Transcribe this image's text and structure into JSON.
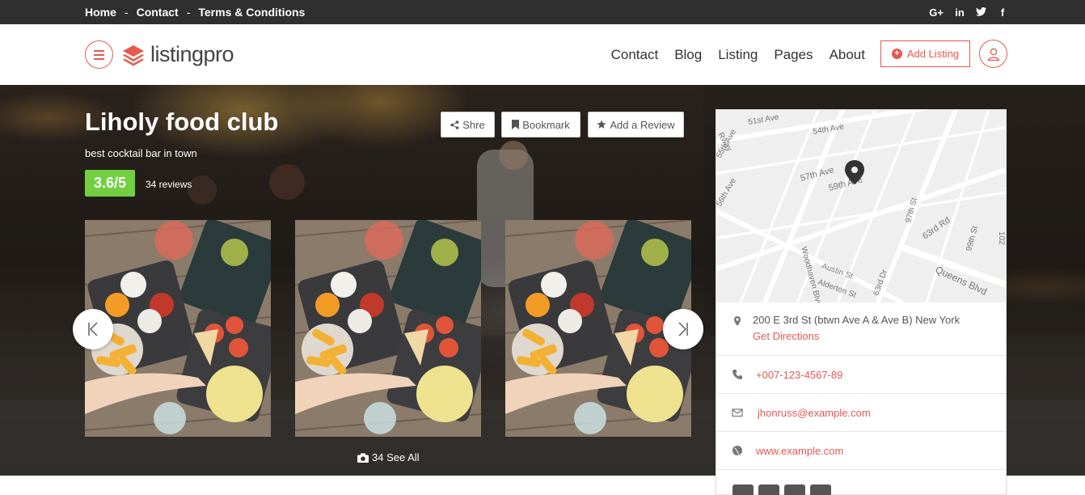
{
  "topnav": {
    "home": "Home",
    "sep1": "-",
    "contact": "Contact",
    "sep2": "-",
    "terms": "Terms & Conditions"
  },
  "social": {
    "gplus": "G+",
    "linkedin": "in",
    "twitter": "🐦",
    "facebook": "f"
  },
  "header": {
    "logo_text": "listingpro",
    "nav": [
      "Contact",
      "Blog",
      "Listing",
      "Pages",
      "About"
    ],
    "add_listing": "Add Listing"
  },
  "listing": {
    "title": "Liholy food club",
    "tagline": "best cocktail bar in town",
    "rating": "3.6/5",
    "reviews": "34 reviews",
    "actions": {
      "share": "Shre",
      "bookmark": "Bookmark",
      "review": "Add a Review"
    },
    "see_all": "34 See All"
  },
  "map": {
    "streets": [
      "51st Ave",
      "54th Ave",
      "57th Ave",
      "59th Ave",
      "56th Ave",
      "55th Ave",
      "97th St",
      "63rd Rd",
      "99th St",
      "Queens Blvd",
      "Austin St",
      "Alderton St",
      "63rd Dr",
      "Woodhaven Blvd",
      "65th Ave",
      "Rway",
      "102"
    ]
  },
  "contact": {
    "address": "200 E 3rd St (btwn Ave A & Ave B) New York",
    "directions": "Get Directions",
    "phone": "+007-123-4567-89",
    "email": "jhonruss@example.com",
    "website": "www.example.com"
  },
  "colors": {
    "accent": "#e5594f",
    "rating_bg": "#73cf42",
    "topbar": "#2f2f2f"
  }
}
